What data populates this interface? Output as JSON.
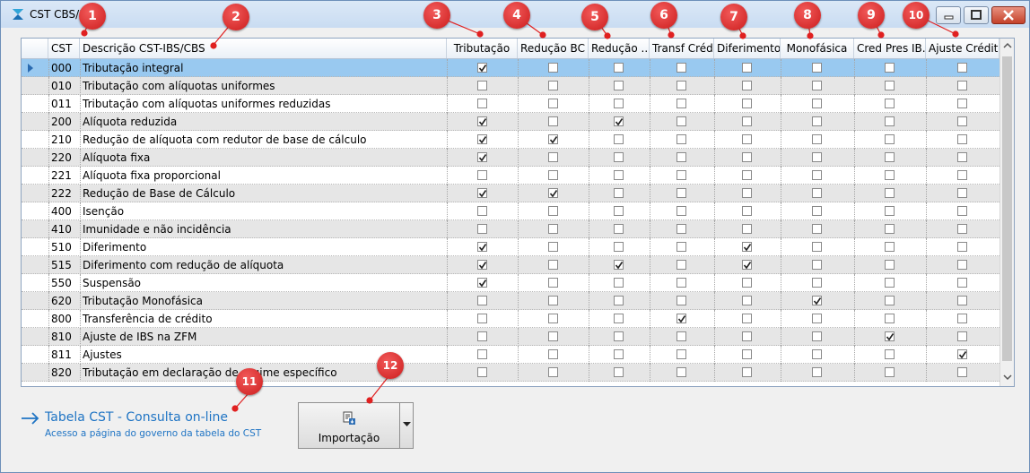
{
  "window": {
    "title": "CST CBS/IBS",
    "controls": {
      "minimize": "minimize-icon",
      "maximize": "maximize-icon",
      "close": "close-icon"
    }
  },
  "grid": {
    "columns": [
      "CST",
      "Descrição CST-IBS/CBS",
      "Tributação",
      "Redução BC",
      "Redução ...",
      "Transf Créd",
      "Diferimento",
      "Monofásica",
      "Cred Pres IB...",
      "Ajuste Crédito"
    ],
    "rows": [
      {
        "cst": "000",
        "desc": "Tributação integral",
        "flags": [
          1,
          0,
          0,
          0,
          0,
          0,
          0,
          0
        ]
      },
      {
        "cst": "010",
        "desc": "Tributação com alíquotas uniformes",
        "flags": [
          0,
          0,
          0,
          0,
          0,
          0,
          0,
          0
        ]
      },
      {
        "cst": "011",
        "desc": "Tributação com alíquotas uniformes reduzidas",
        "flags": [
          0,
          0,
          0,
          0,
          0,
          0,
          0,
          0
        ]
      },
      {
        "cst": "200",
        "desc": "Alíquota reduzida",
        "flags": [
          1,
          0,
          1,
          0,
          0,
          0,
          0,
          0
        ]
      },
      {
        "cst": "210",
        "desc": "Redução de alíquota com redutor de base de cálculo",
        "flags": [
          1,
          1,
          0,
          0,
          0,
          0,
          0,
          0
        ]
      },
      {
        "cst": "220",
        "desc": "Alíquota fixa",
        "flags": [
          1,
          0,
          0,
          0,
          0,
          0,
          0,
          0
        ]
      },
      {
        "cst": "221",
        "desc": "Alíquota fixa proporcional",
        "flags": [
          0,
          0,
          0,
          0,
          0,
          0,
          0,
          0
        ]
      },
      {
        "cst": "222",
        "desc": "Redução de Base de Cálculo",
        "flags": [
          1,
          1,
          0,
          0,
          0,
          0,
          0,
          0
        ]
      },
      {
        "cst": "400",
        "desc": "Isenção",
        "flags": [
          0,
          0,
          0,
          0,
          0,
          0,
          0,
          0
        ]
      },
      {
        "cst": "410",
        "desc": "Imunidade e não incidência",
        "flags": [
          0,
          0,
          0,
          0,
          0,
          0,
          0,
          0
        ]
      },
      {
        "cst": "510",
        "desc": "Diferimento",
        "flags": [
          1,
          0,
          0,
          0,
          1,
          0,
          0,
          0
        ]
      },
      {
        "cst": "515",
        "desc": "Diferimento com redução de alíquota",
        "flags": [
          1,
          0,
          1,
          0,
          1,
          0,
          0,
          0
        ]
      },
      {
        "cst": "550",
        "desc": "Suspensão",
        "flags": [
          1,
          0,
          0,
          0,
          0,
          0,
          0,
          0
        ]
      },
      {
        "cst": "620",
        "desc": "Tributação Monofásica",
        "flags": [
          0,
          0,
          0,
          0,
          0,
          1,
          0,
          0
        ]
      },
      {
        "cst": "800",
        "desc": "Transferência de crédito",
        "flags": [
          0,
          0,
          0,
          1,
          0,
          0,
          0,
          0
        ]
      },
      {
        "cst": "810",
        "desc": "Ajuste de IBS na ZFM",
        "flags": [
          0,
          0,
          0,
          0,
          0,
          0,
          1,
          0
        ]
      },
      {
        "cst": "811",
        "desc": "Ajustes",
        "flags": [
          0,
          0,
          0,
          0,
          0,
          0,
          0,
          1
        ]
      },
      {
        "cst": "820",
        "desc": "Tributação em declaração de regime específico",
        "flags": [
          0,
          0,
          0,
          0,
          0,
          0,
          0,
          0
        ]
      }
    ],
    "selected_row": 0
  },
  "link": {
    "title": "Tabela CST - Consulta on-line",
    "subtitle": "Acesso a página do governo da tabela do CST"
  },
  "import_button": {
    "label": "Importação"
  },
  "badges": [
    "1",
    "2",
    "3",
    "4",
    "5",
    "6",
    "7",
    "8",
    "9",
    "10",
    "11",
    "12"
  ],
  "colors": {
    "selected_row": "#99c9f0",
    "alt_row": "#e6e6e6",
    "link": "#1f74c4",
    "badge": "#d92525"
  }
}
